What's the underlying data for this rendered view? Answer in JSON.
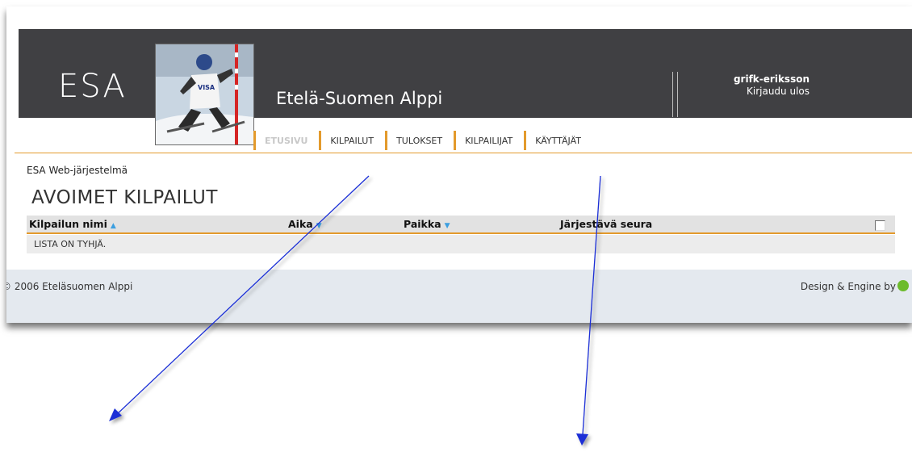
{
  "header": {
    "logo": "ESA",
    "site_name": "Etelä-Suomen Alppi",
    "user_name": "grifk-eriksson",
    "logout": "Kirjaudu ulos"
  },
  "nav": {
    "items": [
      {
        "label": "ETUSIVU",
        "active": true
      },
      {
        "label": "KILPAILUT",
        "active": false
      },
      {
        "label": "TULOKSET",
        "active": false
      },
      {
        "label": "KILPAILIJAT",
        "active": false
      },
      {
        "label": "KÄYTTÄJÄT",
        "active": false
      }
    ]
  },
  "main": {
    "system_name": "ESA Web-järjestelmä",
    "title": "AVOIMET KILPAILUT",
    "table": {
      "columns": [
        "Kilpailun nimi",
        "Aika",
        "Paikka",
        "Järjestävä seura"
      ],
      "empty_text": "LISTA ON TYHJÄ."
    }
  },
  "footer": {
    "copyright": "© 2006 Eteläsuomen Alppi",
    "credit": "Design & Engine by"
  },
  "colors": {
    "header_bg": "#404043",
    "accent": "#e39a2c",
    "sort_arrow": "#3c9fe0",
    "footer_bg": "#e4e9ef",
    "annotation_arrow": "#1a2fd6"
  }
}
